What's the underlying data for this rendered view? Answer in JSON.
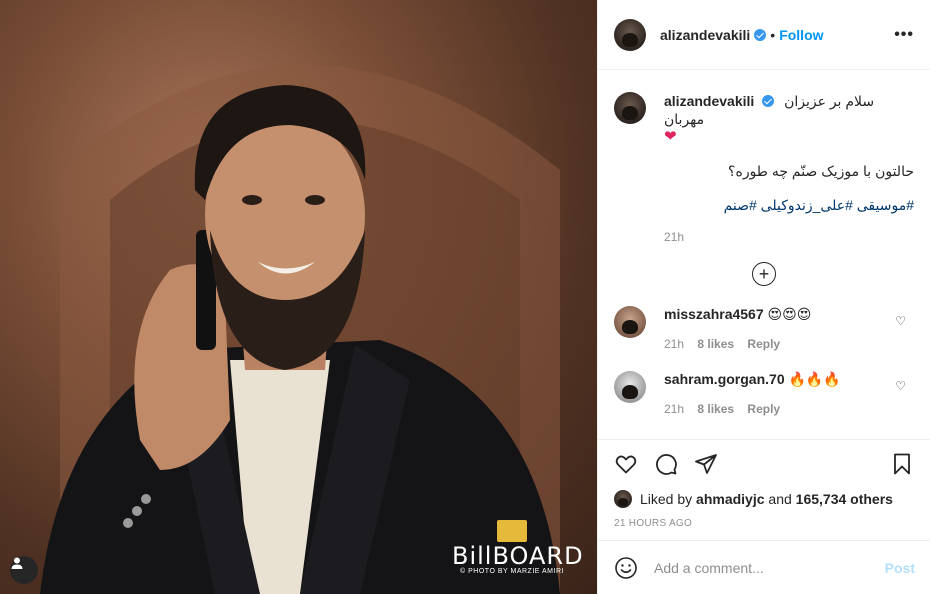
{
  "post": {
    "author": "alizandevakili",
    "follow_label": "Follow",
    "separator": "•",
    "more_label": "•••"
  },
  "photo": {
    "watermark_brand": "BillBOARD",
    "watermark_credit": "© PHOTO BY MARZIE AMIRI",
    "tag_icon": "user-tag-icon"
  },
  "caption": {
    "username": "alizandevakili",
    "line1": "سلام بر عزیزان مهربان",
    "line1_emoji": "❤",
    "line2": "حالتون با موزیک صنّم چه طوره؟",
    "hashtags": "#موسیقی #علی_زندوکیلی #صنم",
    "time": "21h"
  },
  "comments": [
    {
      "username": "misszahra4567",
      "text": "😍😍😍",
      "time": "21h",
      "likes": "8 likes",
      "reply": "Reply"
    },
    {
      "username": "sahram.gorgan.70",
      "text": "🔥🔥🔥",
      "time": "21h",
      "likes": "8 likes",
      "reply": "Reply"
    }
  ],
  "likes": {
    "prefix": "Liked by",
    "user": "ahmadiyjc",
    "and": "and",
    "others": "165,734 others"
  },
  "posted_time": "21 HOURS AGO",
  "add_comment": {
    "placeholder": "Add a comment...",
    "post_label": "Post"
  },
  "colors": {
    "accent": "#0095f6",
    "verified": "#3897f0",
    "hashtag": "#00376b",
    "muted": "#8e8e8e"
  }
}
